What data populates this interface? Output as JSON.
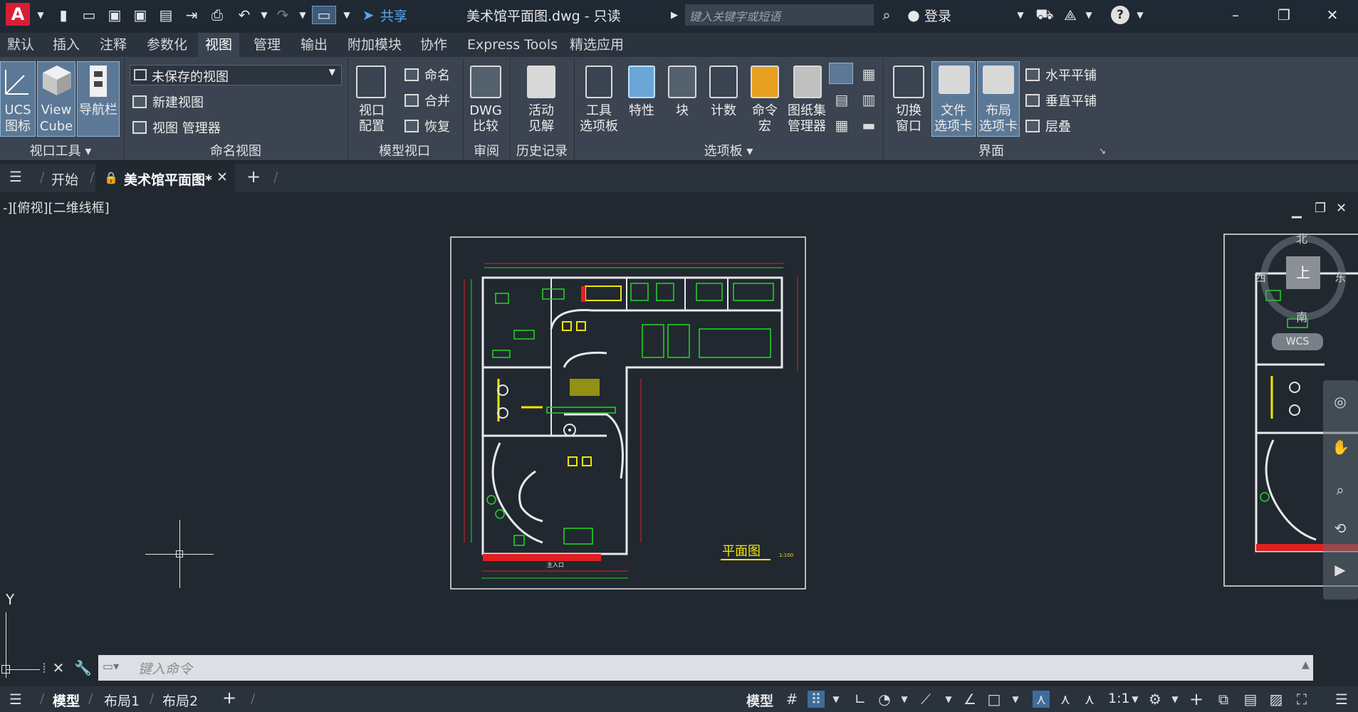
{
  "titlebar": {
    "app_logo": "A",
    "share_label": "共享",
    "title": "美术馆平面图.dwg - 只读",
    "search_placeholder": "键入关键字或短语",
    "login_label": "登录",
    "help_label": "?"
  },
  "ribbon_tabs": [
    "默认",
    "插入",
    "注释",
    "参数化",
    "视图",
    "管理",
    "输出",
    "附加模块",
    "协作",
    "Express Tools",
    "精选应用"
  ],
  "ribbon": {
    "viewport_tools": {
      "title": "视口工具",
      "ucs": [
        "UCS",
        "图标"
      ],
      "viewcube": [
        "View",
        "Cube"
      ],
      "navbar": "导航栏"
    },
    "named_views": {
      "title": "命名视图",
      "current_view": "未保存的视图",
      "new_view": "新建视图",
      "view_manager": "视图 管理器"
    },
    "model_viewports": {
      "title": "模型视口",
      "config": [
        "视口",
        "配置"
      ],
      "name": "命名",
      "join": "合并",
      "restore": "恢复"
    },
    "compare": {
      "title": "审阅",
      "dwg": [
        "DWG",
        "比较"
      ]
    },
    "history": {
      "title": "历史记录",
      "activity": [
        "活动",
        "见解"
      ]
    },
    "palettes": {
      "title": "选项板",
      "tool_palette": [
        "工具",
        "选项板"
      ],
      "properties": "特性",
      "block": "块",
      "count": "计数",
      "macro": [
        "命令",
        "宏"
      ],
      "sheetset": [
        "图纸集",
        "管理器"
      ]
    },
    "interface": {
      "title": "界面",
      "switch_window": [
        "切换",
        "窗口"
      ],
      "file_tabs": [
        "文件",
        "选项卡"
      ],
      "layout_tabs": [
        "布局",
        "选项卡"
      ],
      "tile_h": "水平平铺",
      "tile_v": "垂直平铺",
      "cascade": "层叠"
    }
  },
  "file_tabs": {
    "start": "开始",
    "current": "美术馆平面图*"
  },
  "viewport": {
    "label": "-][俯视][二维线框]",
    "compass": {
      "north": "北",
      "south": "南",
      "west": "西",
      "east": "东",
      "top": "上",
      "wcs": "WCS"
    },
    "ucs_y": "Y",
    "drawing_title": "平面图",
    "drawing_scale": "1:100",
    "entrance": "主入口"
  },
  "command_line": {
    "placeholder": "键入命令"
  },
  "status_tabs": [
    "模型",
    "布局1",
    "布局2"
  ],
  "status_right": {
    "model": "模型",
    "scale": "1:1"
  },
  "colors": {
    "accent": "#d81e36",
    "drawing_green": "#22d822",
    "drawing_red": "#e02020",
    "drawing_yellow": "#f0e600",
    "wall_white": "#e8e8e8"
  }
}
